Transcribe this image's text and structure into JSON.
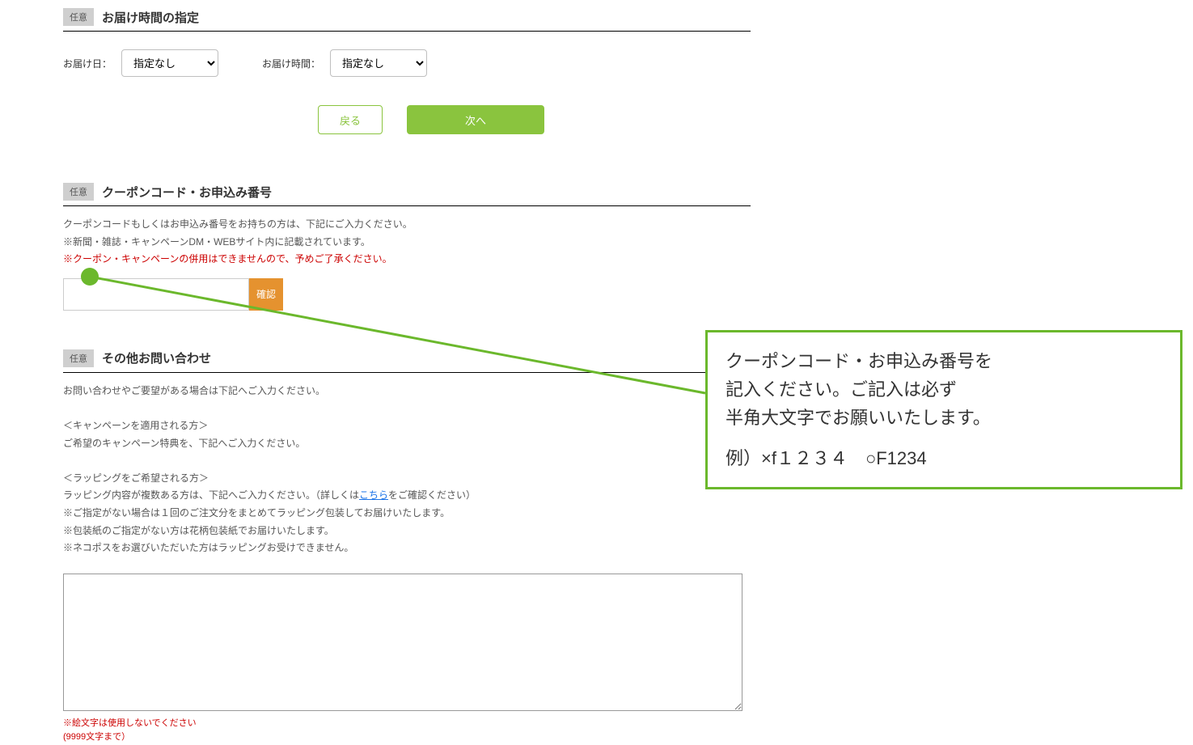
{
  "delivery": {
    "badge": "任意",
    "title": "お届け時間の指定",
    "date_label": "お届け日：",
    "date_value": "指定なし",
    "time_label": "お届け時間：",
    "time_value": "指定なし"
  },
  "buttons": {
    "back": "戻る",
    "next": "次へ"
  },
  "coupon": {
    "badge": "任意",
    "title": "クーポンコード・お申込み番号",
    "desc1": "クーポンコードもしくはお申込み番号をお持ちの方は、下記にご入力ください。",
    "desc2": "※新聞・雑誌・キャンペーンDM・WEBサイト内に記載されています。",
    "desc3": "※クーポン・キャンペーンの併用はできませんので、予めご了承ください。",
    "confirm": "確認"
  },
  "inquiry": {
    "badge": "任意",
    "title": "その他お問い合わせ",
    "line1": "お問い合わせやご要望がある場合は下記へご入力ください。",
    "campaign_h": "＜キャンペーンを適用される方＞",
    "campaign_1": "ご希望のキャンペーン特典を、下記へご入力ください。",
    "wrap_h": "＜ラッピングをご希望される方＞",
    "wrap_1a": "ラッピング内容が複数ある方は、下記へご入力ください。（詳しくは",
    "wrap_1link": "こちら",
    "wrap_1b": "をご確認ください）",
    "wrap_2": "※ご指定がない場合は１回のご注文分をまとめてラッピング包装してお届けいたします。",
    "wrap_3": "※包装紙のご指定がない方は花柄包装紙でお届けいたします。",
    "wrap_4": "※ネコポスをお選びいただいた方はラッピングお受けできません。",
    "note1": "※絵文字は使用しないでください",
    "note2": "(9999文字まで）"
  },
  "callout": {
    "l1": "クーポンコード・お申込み番号を",
    "l2": "記入ください。ご記入は必ず",
    "l3": "半角大文字でお願いいたします。",
    "ex": "例）×f１２３４　○F1234"
  }
}
